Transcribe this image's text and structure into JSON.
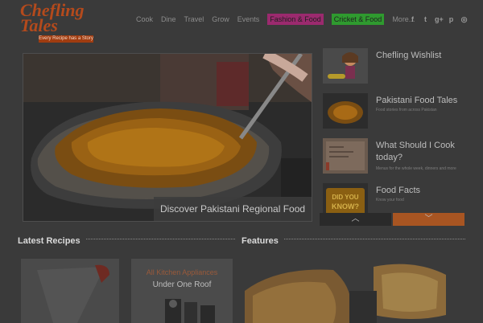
{
  "logo": {
    "line1": "Chefling",
    "line2": "Tales",
    "tagline": "Every Recipe has a Story"
  },
  "nav": {
    "items": [
      {
        "label": "Cook",
        "bg": ""
      },
      {
        "label": "Dine",
        "bg": ""
      },
      {
        "label": "Travel",
        "bg": ""
      },
      {
        "label": "Grow",
        "bg": ""
      },
      {
        "label": "Events",
        "bg": ""
      },
      {
        "label": "Fashion & Food",
        "bg": "#9b2a6e"
      },
      {
        "label": "Cricket & Food",
        "bg": "#2f9a2f"
      },
      {
        "label": "More...",
        "bg": ""
      }
    ]
  },
  "social": [
    {
      "icon": "facebook-icon",
      "glyph": "f"
    },
    {
      "icon": "twitter-icon",
      "glyph": "t"
    },
    {
      "icon": "google-plus-icon",
      "glyph": "g+"
    },
    {
      "icon": "pinterest-icon",
      "glyph": "p"
    },
    {
      "icon": "instagram-icon",
      "glyph": "◎"
    }
  ],
  "hero": {
    "caption": "Discover Pakistani Regional Food"
  },
  "features_list": [
    {
      "title": "Chefling Wishlist",
      "desc": ""
    },
    {
      "title": "Pakistani Food Tales",
      "desc": "Food stories from across Pakistan"
    },
    {
      "title": "What Should I Cook today?",
      "desc": "Menus for the whole week, dinners and more"
    },
    {
      "title": "Food Facts",
      "desc": "Know your food"
    }
  ],
  "thumb_text": {
    "appliance_line1": "All Kitchen Appliances",
    "appliance_line2": "Under One Roof",
    "did_you_know": "DID YOU KNOW?"
  },
  "sections": {
    "latest": "Latest Recipes",
    "features": "Features"
  },
  "colors": {
    "brand": "#b44a1c",
    "slider_down": "#a85522",
    "slider_up": "#2a2a2a"
  }
}
